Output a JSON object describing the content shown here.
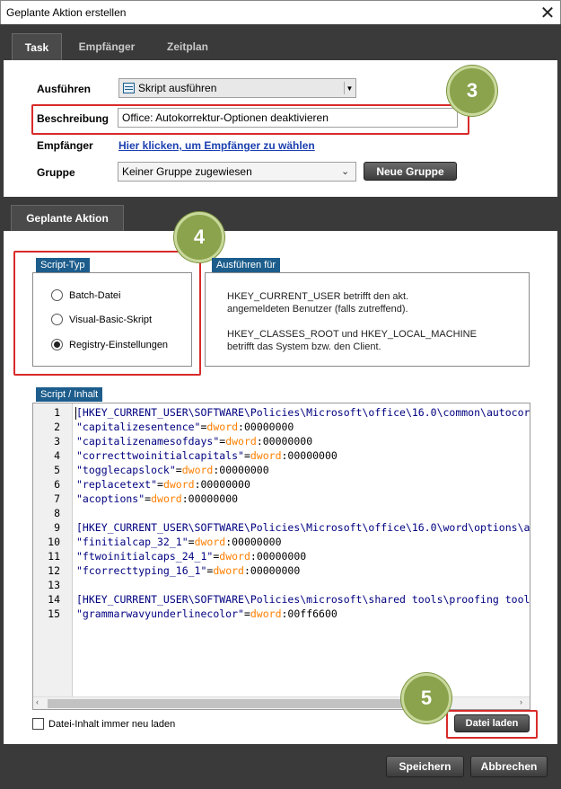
{
  "window": {
    "title": "Geplante Aktion erstellen",
    "close_glyph": "✕"
  },
  "tabs": [
    {
      "label": "Task",
      "active": true
    },
    {
      "label": "Empfänger",
      "active": false
    },
    {
      "label": "Zeitplan",
      "active": false
    }
  ],
  "task_form": {
    "execute_label": "Ausführen",
    "execute_value": "Skript ausführen",
    "description_label": "Beschreibung",
    "description_value": "Office: Autokorrektur-Optionen deaktivieren",
    "recipients_label": "Empfänger",
    "recipients_link": "Hier klicken, um Empfänger zu wählen",
    "group_label": "Gruppe",
    "group_value": "Keiner Gruppe zugewiesen",
    "new_group_button": "Neue Gruppe"
  },
  "callouts": {
    "badge_3": "3",
    "badge_4": "4",
    "badge_5": "5"
  },
  "section_tab": "Geplante Aktion",
  "script_type": {
    "title": "Script-Typ",
    "options": [
      {
        "label": "Batch-Datei",
        "selected": false
      },
      {
        "label": "Visual-Basic-Skript",
        "selected": false
      },
      {
        "label": "Registry-Einstellungen",
        "selected": true
      }
    ]
  },
  "run_for": {
    "title": "Ausführen für",
    "line1": "HKEY_CURRENT_USER betrifft den akt.",
    "line2": "angemeldeten Benutzer (falls zutreffend).",
    "line3": "HKEY_CLASSES_ROOT und HKEY_LOCAL_MACHINE",
    "line4": "betrifft das System bzw. den Client."
  },
  "script_content": {
    "title": "Script / Inhalt",
    "lines": [
      {
        "n": "1",
        "parts": [
          [
            "br",
            "[HKEY_CURRENT_USER\\SOFTWARE\\Policies\\Microsoft\\office\\16.0\\common\\autocor"
          ]
        ]
      },
      {
        "n": "2",
        "parts": [
          [
            "str",
            "\"capitalizesentence\""
          ],
          [
            "num",
            "="
          ],
          [
            "key",
            "dword"
          ],
          [
            "num",
            ":00000000"
          ]
        ]
      },
      {
        "n": "3",
        "parts": [
          [
            "str",
            "\"capitalizenamesofdays\""
          ],
          [
            "num",
            "="
          ],
          [
            "key",
            "dword"
          ],
          [
            "num",
            ":00000000"
          ]
        ]
      },
      {
        "n": "4",
        "parts": [
          [
            "str",
            "\"correcttwoinitialcapitals\""
          ],
          [
            "num",
            "="
          ],
          [
            "key",
            "dword"
          ],
          [
            "num",
            ":00000000"
          ]
        ]
      },
      {
        "n": "5",
        "parts": [
          [
            "str",
            "\"togglecapslock\""
          ],
          [
            "num",
            "="
          ],
          [
            "key",
            "dword"
          ],
          [
            "num",
            ":00000000"
          ]
        ]
      },
      {
        "n": "6",
        "parts": [
          [
            "str",
            "\"replacetext\""
          ],
          [
            "num",
            "="
          ],
          [
            "key",
            "dword"
          ],
          [
            "num",
            ":00000000"
          ]
        ]
      },
      {
        "n": "7",
        "parts": [
          [
            "str",
            "\"acoptions\""
          ],
          [
            "num",
            "="
          ],
          [
            "key",
            "dword"
          ],
          [
            "num",
            ":00000000"
          ]
        ]
      },
      {
        "n": "8",
        "parts": []
      },
      {
        "n": "9",
        "parts": [
          [
            "br",
            "[HKEY_CURRENT_USER\\SOFTWARE\\Policies\\Microsoft\\office\\16.0\\word\\options\\a"
          ]
        ]
      },
      {
        "n": "10",
        "parts": [
          [
            "str",
            "\"finitialcap_32_1\""
          ],
          [
            "num",
            "="
          ],
          [
            "key",
            "dword"
          ],
          [
            "num",
            ":00000000"
          ]
        ]
      },
      {
        "n": "11",
        "parts": [
          [
            "str",
            "\"ftwoinitialcaps_24_1\""
          ],
          [
            "num",
            "="
          ],
          [
            "key",
            "dword"
          ],
          [
            "num",
            ":00000000"
          ]
        ]
      },
      {
        "n": "12",
        "parts": [
          [
            "str",
            "\"fcorrecttyping_16_1\""
          ],
          [
            "num",
            "="
          ],
          [
            "key",
            "dword"
          ],
          [
            "num",
            ":00000000"
          ]
        ]
      },
      {
        "n": "13",
        "parts": []
      },
      {
        "n": "14",
        "parts": [
          [
            "br",
            "[HKEY_CURRENT_USER\\SOFTWARE\\Policies\\microsoft\\shared tools\\proofing tool"
          ]
        ]
      },
      {
        "n": "15",
        "parts": [
          [
            "str",
            "\"grammarwavyunderlinecolor\""
          ],
          [
            "num",
            "="
          ],
          [
            "key",
            "dword"
          ],
          [
            "num",
            ":00ff6600"
          ]
        ]
      }
    ]
  },
  "reload_checkbox": {
    "label": "Datei-Inhalt immer neu laden",
    "checked": false
  },
  "load_file_button": "Datei laden",
  "footer": {
    "save_button": "Speichern",
    "cancel_button": "Abbrechen"
  },
  "colors": {
    "accent_blue": "#1c5d8c",
    "callout_red": "#d92a2a",
    "badge_green": "#8aa34c",
    "frame_dark": "#3a3a3a"
  }
}
